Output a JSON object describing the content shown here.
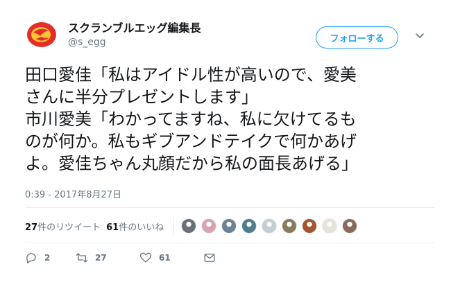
{
  "author": {
    "display_name": "スクランブルエッグ編集長",
    "handle": "@s_egg",
    "avatar_icon": "egg-logo-icon",
    "avatar_colors": {
      "outer": "#e52d27",
      "inner": "#f7c630"
    }
  },
  "follow_button": {
    "label": "フォローする"
  },
  "menu": {
    "icon": "chevron-down-icon"
  },
  "tweet": {
    "lines": [
      "田口愛佳「私はアイドル性が高いので、愛美",
      "さんに半分プレゼントします」",
      "市川愛美「わかってますね、私に欠けてるも",
      "のが何か。私もギブアンドテイクで何かあげ",
      "よ。愛佳ちゃん丸顔だから私の面長あげる」"
    ],
    "timestamp": "0:39 - 2017年8月27日"
  },
  "stats": {
    "retweets_count": "27",
    "retweets_label": "件のリツイート",
    "likes_count": "61",
    "likes_label": "件のいいね",
    "likers": [
      {
        "icon": "avatar-icon",
        "color": "#6b6f7a"
      },
      {
        "icon": "avatar-icon",
        "color": "#d9a3b3"
      },
      {
        "icon": "avatar-icon",
        "color": "#6e8296"
      },
      {
        "icon": "avatar-icon",
        "color": "#4f7d8c"
      },
      {
        "icon": "avatar-icon",
        "color": "#c4ccd4"
      },
      {
        "icon": "avatar-icon",
        "color": "#8a7a5c"
      },
      {
        "icon": "avatar-icon",
        "color": "#a3562f"
      },
      {
        "icon": "avatar-icon",
        "color": "#e8e2d8"
      },
      {
        "icon": "avatar-icon",
        "color": "#8c6a5a"
      }
    ]
  },
  "actions": {
    "reply_count": "2",
    "retweet_count": "27",
    "like_count": "61",
    "icons": [
      "reply-icon",
      "retweet-icon",
      "heart-icon",
      "message-icon"
    ]
  }
}
